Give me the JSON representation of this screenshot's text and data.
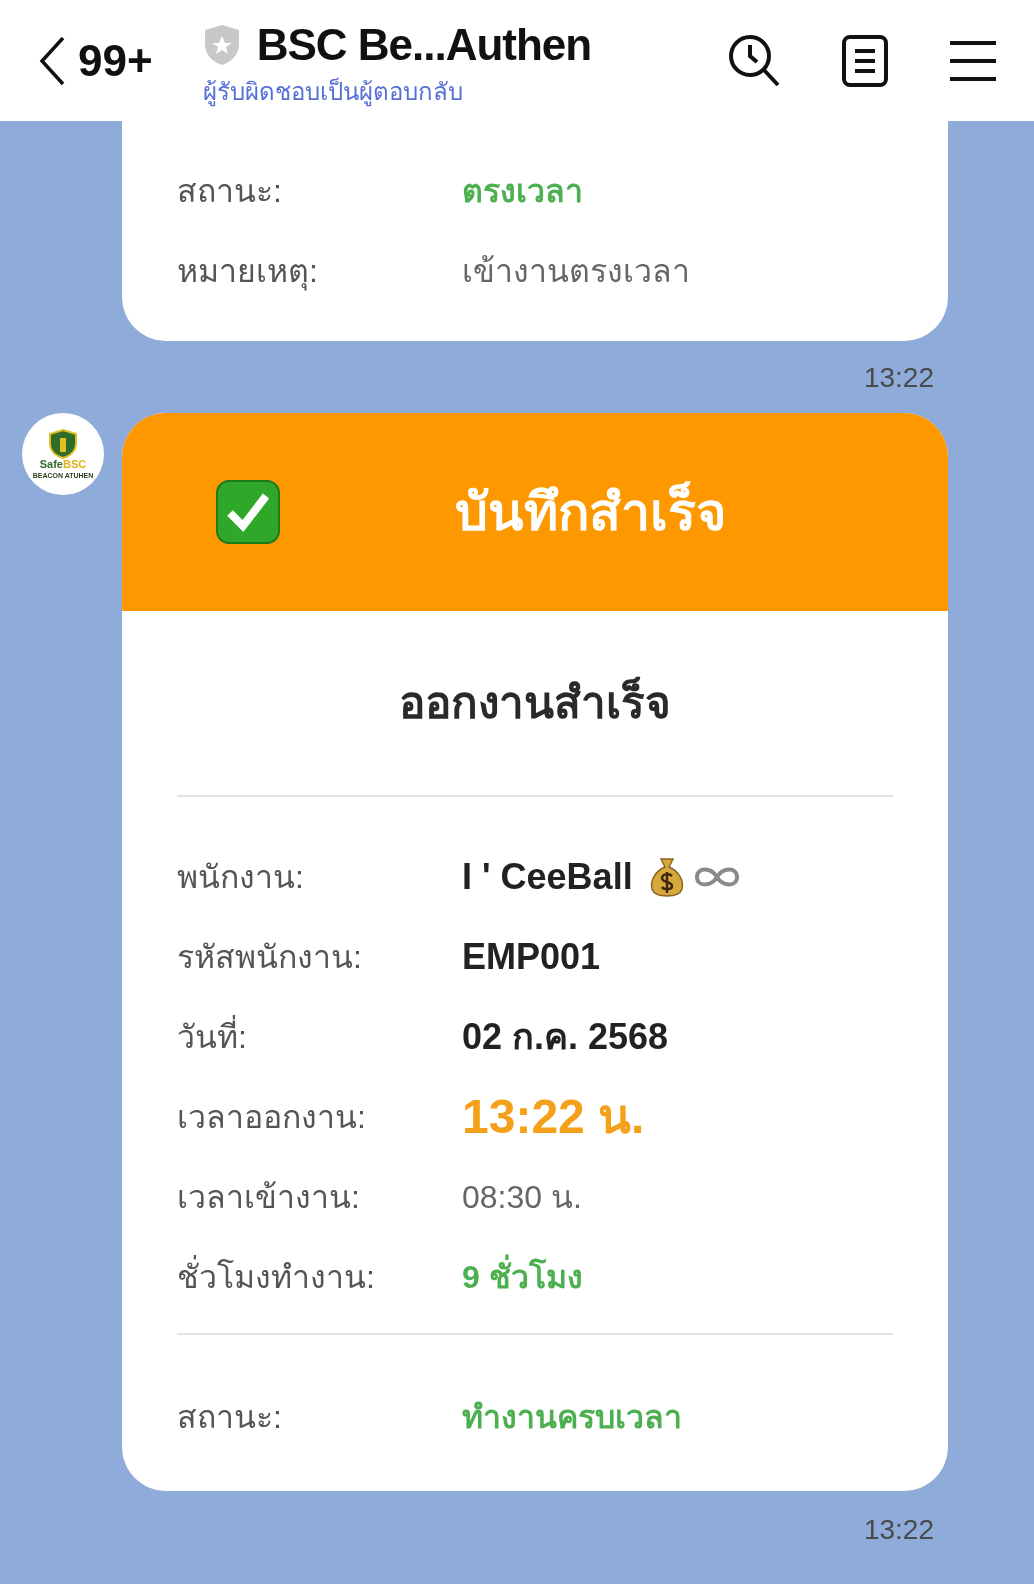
{
  "header": {
    "back_count": "99+",
    "title": "BSC Be...Authen",
    "subtitle": "ผู้รับผิดชอบเป็นผู้ตอบกลับ"
  },
  "previous_card": {
    "rows": [
      {
        "label": "สถานะ:",
        "value": "ตรงเวลา",
        "kind": "green"
      },
      {
        "label": "หมายเหตุ:",
        "value": "เข้างานตรงเวลา",
        "kind": "gray"
      }
    ],
    "time": "13:22"
  },
  "sender": {
    "logo_name": "Safe",
    "logo_name_accent": "BSC",
    "logo_tagline": "BEACON ATUHEN"
  },
  "card": {
    "banner": "บันทึกสำเร็จ",
    "heading": "ออกงานสำเร็จ",
    "employee": {
      "label": "พนักงาน:",
      "value": "I ' CeeBall"
    },
    "rows": [
      {
        "label": "รหัสพนักงาน:",
        "value": "EMP001",
        "kind": "dark"
      },
      {
        "label": "วันที่:",
        "value": "02 ก.ค. 2568",
        "kind": "dark"
      },
      {
        "label": "เวลาออกงาน:",
        "value": "13:22 น.",
        "kind": "orange"
      },
      {
        "label": "เวลาเข้างาน:",
        "value": "08:30 น.",
        "kind": "gray"
      },
      {
        "label": "ชั่วโมงทำงาน:",
        "value": "9 ชั่วโมง",
        "kind": "green"
      }
    ],
    "status": {
      "label": "สถานะ:",
      "value": "ทำงานครบเวลา",
      "kind": "green"
    },
    "time": "13:22"
  }
}
